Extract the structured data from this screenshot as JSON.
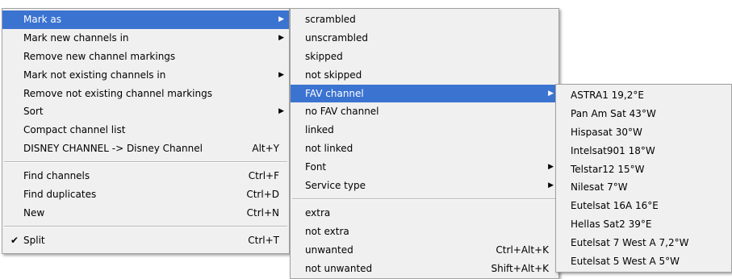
{
  "menu1": {
    "items": [
      {
        "label": "Mark as",
        "shortcut": "",
        "arrow": "▶"
      },
      {
        "label": "Mark new channels in",
        "shortcut": "",
        "arrow": "▶"
      },
      {
        "label": "Remove new channel markings",
        "shortcut": "",
        "arrow": ""
      },
      {
        "label": "Mark not existing channels in",
        "shortcut": "",
        "arrow": "▶"
      },
      {
        "label": "Remove not existing channel markings",
        "shortcut": "",
        "arrow": ""
      },
      {
        "label": "Sort",
        "shortcut": "",
        "arrow": "▶"
      },
      {
        "label": "Compact channel list",
        "shortcut": "",
        "arrow": ""
      },
      {
        "label": "DISNEY CHANNEL -> Disney Channel",
        "shortcut": "Alt+Y",
        "arrow": ""
      },
      {
        "label": "Find channels",
        "shortcut": "Ctrl+F",
        "arrow": ""
      },
      {
        "label": "Find duplicates",
        "shortcut": "Ctrl+D",
        "arrow": ""
      },
      {
        "label": "New",
        "shortcut": "Ctrl+N",
        "arrow": ""
      },
      {
        "label": "Split",
        "shortcut": "Ctrl+T",
        "arrow": "",
        "check": "✔"
      }
    ]
  },
  "menu2": {
    "items": [
      {
        "label": "scrambled",
        "shortcut": "",
        "arrow": ""
      },
      {
        "label": "unscrambled",
        "shortcut": "",
        "arrow": ""
      },
      {
        "label": "skipped",
        "shortcut": "",
        "arrow": ""
      },
      {
        "label": "not skipped",
        "shortcut": "",
        "arrow": ""
      },
      {
        "label": "FAV channel",
        "shortcut": "",
        "arrow": "▶"
      },
      {
        "label": "no FAV channel",
        "shortcut": "",
        "arrow": ""
      },
      {
        "label": "linked",
        "shortcut": "",
        "arrow": ""
      },
      {
        "label": "not linked",
        "shortcut": "",
        "arrow": ""
      },
      {
        "label": "Font",
        "shortcut": "",
        "arrow": "▶"
      },
      {
        "label": "Service type",
        "shortcut": "",
        "arrow": "▶"
      },
      {
        "label": "extra",
        "shortcut": "",
        "arrow": ""
      },
      {
        "label": "not extra",
        "shortcut": "",
        "arrow": ""
      },
      {
        "label": "unwanted",
        "shortcut": "Ctrl+Alt+K",
        "arrow": ""
      },
      {
        "label": "not unwanted",
        "shortcut": "Shift+Alt+K",
        "arrow": ""
      }
    ]
  },
  "menu3": {
    "items": [
      {
        "label": "ASTRA1 19,2°E"
      },
      {
        "label": "Pan Am Sat 43°W"
      },
      {
        "label": "Hispasat 30°W"
      },
      {
        "label": "Intelsat901 18°W"
      },
      {
        "label": "Telstar12 15°W"
      },
      {
        "label": "Nilesat 7°W"
      },
      {
        "label": "Eutelsat 16A 16°E"
      },
      {
        "label": "Hellas Sat2 39°E"
      },
      {
        "label": "Eutelsat 7 West A 7,2°W"
      },
      {
        "label": "Eutelsat 5 West A 5°W"
      }
    ]
  },
  "colors": {
    "highlight": "#3b73d1",
    "menu_bg": "#f0f0f0"
  }
}
